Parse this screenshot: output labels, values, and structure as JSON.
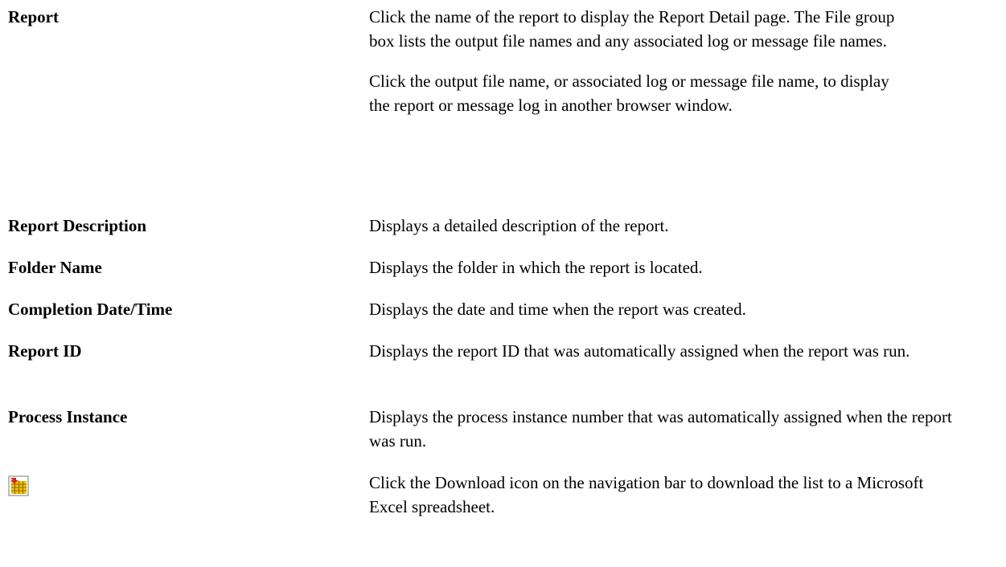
{
  "fields": [
    {
      "term": "Report",
      "paragraphs": [
        "Click the name of the report to display the Report Detail page. The File group box lists the output file names and any associated log or message file names.",
        "Click the output file name, or associated log or message file name, to display the report or message log in another browser window."
      ]
    },
    {
      "term": "Report Description",
      "paragraphs": [
        "Displays a detailed description of the report."
      ]
    },
    {
      "term": "Folder Name",
      "paragraphs": [
        "Displays the folder in which the report is located."
      ]
    },
    {
      "term": "Completion Date/Time",
      "paragraphs": [
        "Displays the date and time when the report was created."
      ]
    },
    {
      "term": "Report ID",
      "paragraphs": [
        "Displays the report ID that was automatically assigned when the report was run."
      ]
    },
    {
      "term": "Process Instance",
      "paragraphs": [
        "Displays the process instance number that was automatically assigned when the report was run."
      ]
    },
    {
      "icon": "download-to-excel-icon",
      "paragraphs": [
        "Click the Download icon on the navigation bar to download the list to a Microsoft Excel spreadsheet."
      ]
    }
  ],
  "colors": {
    "text": "#000000",
    "icon_grid": "#f2c100",
    "icon_border": "#7a7a7a",
    "icon_arrow": "#d32020"
  }
}
